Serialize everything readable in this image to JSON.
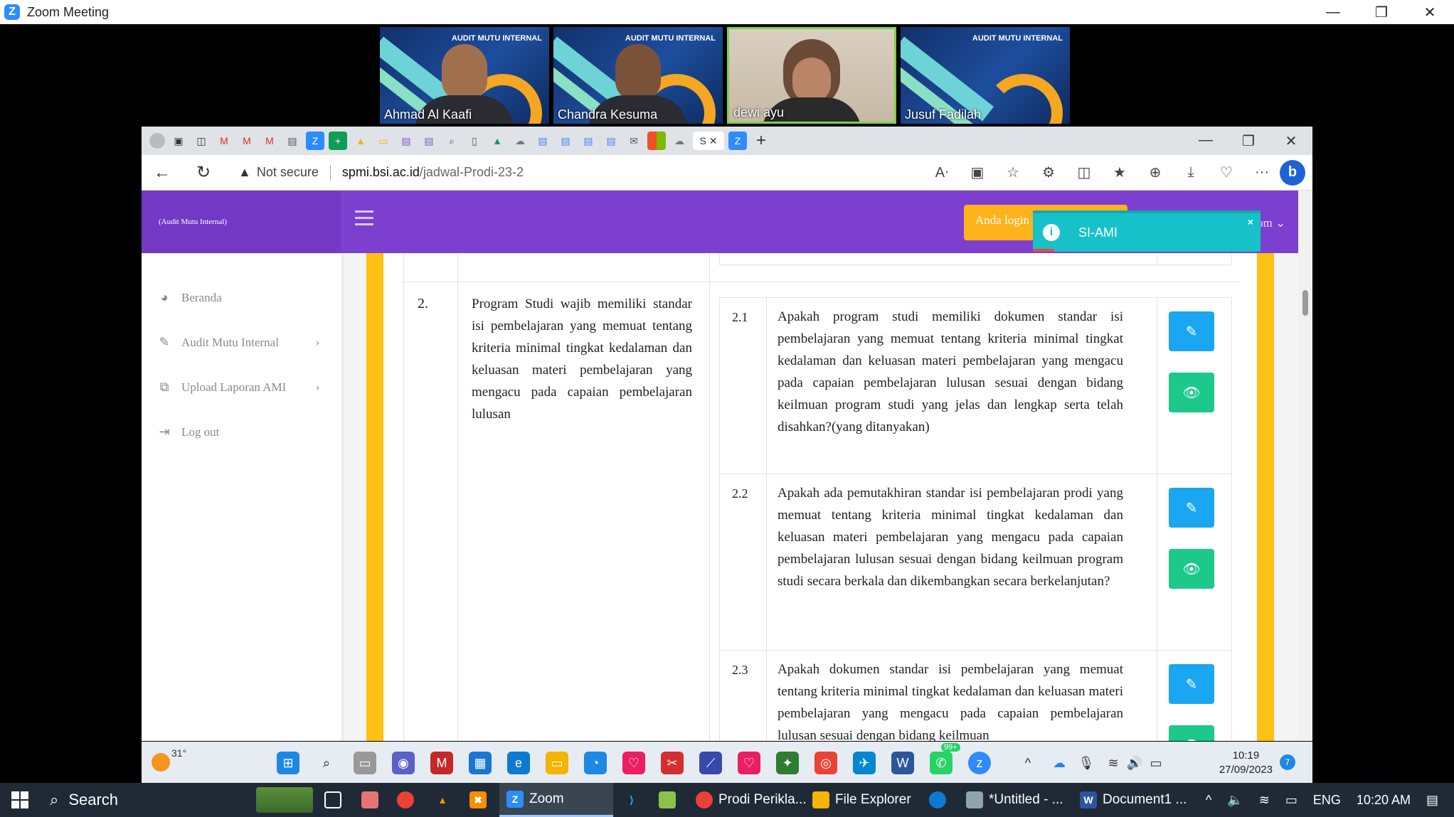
{
  "zoom": {
    "title": "Zoom Meeting",
    "participants": [
      {
        "name": "Ahmad Al Kaafi",
        "header": "AUDIT MUTU INTERNAL"
      },
      {
        "name": "Chandra Kesuma",
        "header": "AUDIT MUTU INTERNAL"
      },
      {
        "name": "dewi ayu",
        "header": ""
      },
      {
        "name": "Jusuf Fadilah",
        "header": "AUDIT MUTU INTERNAL"
      }
    ]
  },
  "browser": {
    "not_secure": "Not secure",
    "url_host": "spmi.bsi.ac.id",
    "url_path": "/jadwal-Prodi-23-2",
    "active_tab_label": "S"
  },
  "site": {
    "brand": "(Audit Mutu Internal)",
    "login_badge": "Anda login",
    "user_menu": "om ⌄",
    "toast_title": "SI-AMI",
    "sidebar": [
      {
        "label": "Beranda",
        "icon": "dashboard-icon"
      },
      {
        "label": "Audit Mutu Internal",
        "icon": "edit-icon"
      },
      {
        "label": "Upload Laporan AMI",
        "icon": "files-icon"
      },
      {
        "label": "Log out",
        "icon": "logout-icon"
      }
    ]
  },
  "standard": {
    "number": "2.",
    "text": "Program Studi wajib memiliki standar isi pembelajaran yang memuat tentang kriteria minimal tingkat kedalaman dan keluasan materi pembelajaran yang mengacu pada capaian pembelajaran lulusan",
    "questions": [
      {
        "no": "2.1",
        "text": "Apakah program studi memiliki dokumen standar isi pembelajaran yang memuat tentang kriteria minimal tingkat kedalaman dan keluasan materi pembelajaran yang mengacu pada capaian pembelajaran lulusan sesuai dengan bidang keilmuan program studi yang jelas dan lengkap serta telah disahkan?(yang ditanyakan)"
      },
      {
        "no": "2.2",
        "text": "Apakah ada pemutakhiran standar isi pembelajaran prodi yang memuat tentang kriteria minimal tingkat kedalaman dan keluasan materi pembelajaran yang mengacu pada capaian pembelajaran lulusan sesuai dengan bidang keilmuan program studi secara berkala dan dikembangkan secara berkelanjutan?"
      },
      {
        "no": "2.3",
        "text": "Apakah dokumen standar isi pembelajaran yang memuat tentang kriteria minimal tingkat kedalaman dan keluasan materi pembelajaran yang mengacu pada capaian pembelajaran lulusan sesuai dengan bidang keilmuan"
      }
    ]
  },
  "inner_taskbar": {
    "temp": "31°",
    "time": "10:19",
    "date": "27/09/2023",
    "badge_whatsapp": "99+",
    "badge_notif": "7"
  },
  "outer_taskbar": {
    "search": "Search",
    "items": [
      {
        "label": "Zoom",
        "icon": "zoom-icon"
      },
      {
        "label": "Prodi Perikla...",
        "icon": "chrome-icon"
      },
      {
        "label": "File Explorer",
        "icon": "folder-icon"
      },
      {
        "label": "*Untitled - ...",
        "icon": "notepad-icon"
      },
      {
        "label": "Document1 ...",
        "icon": "word-icon"
      }
    ],
    "lang": "ENG",
    "time": "10:20 AM"
  }
}
